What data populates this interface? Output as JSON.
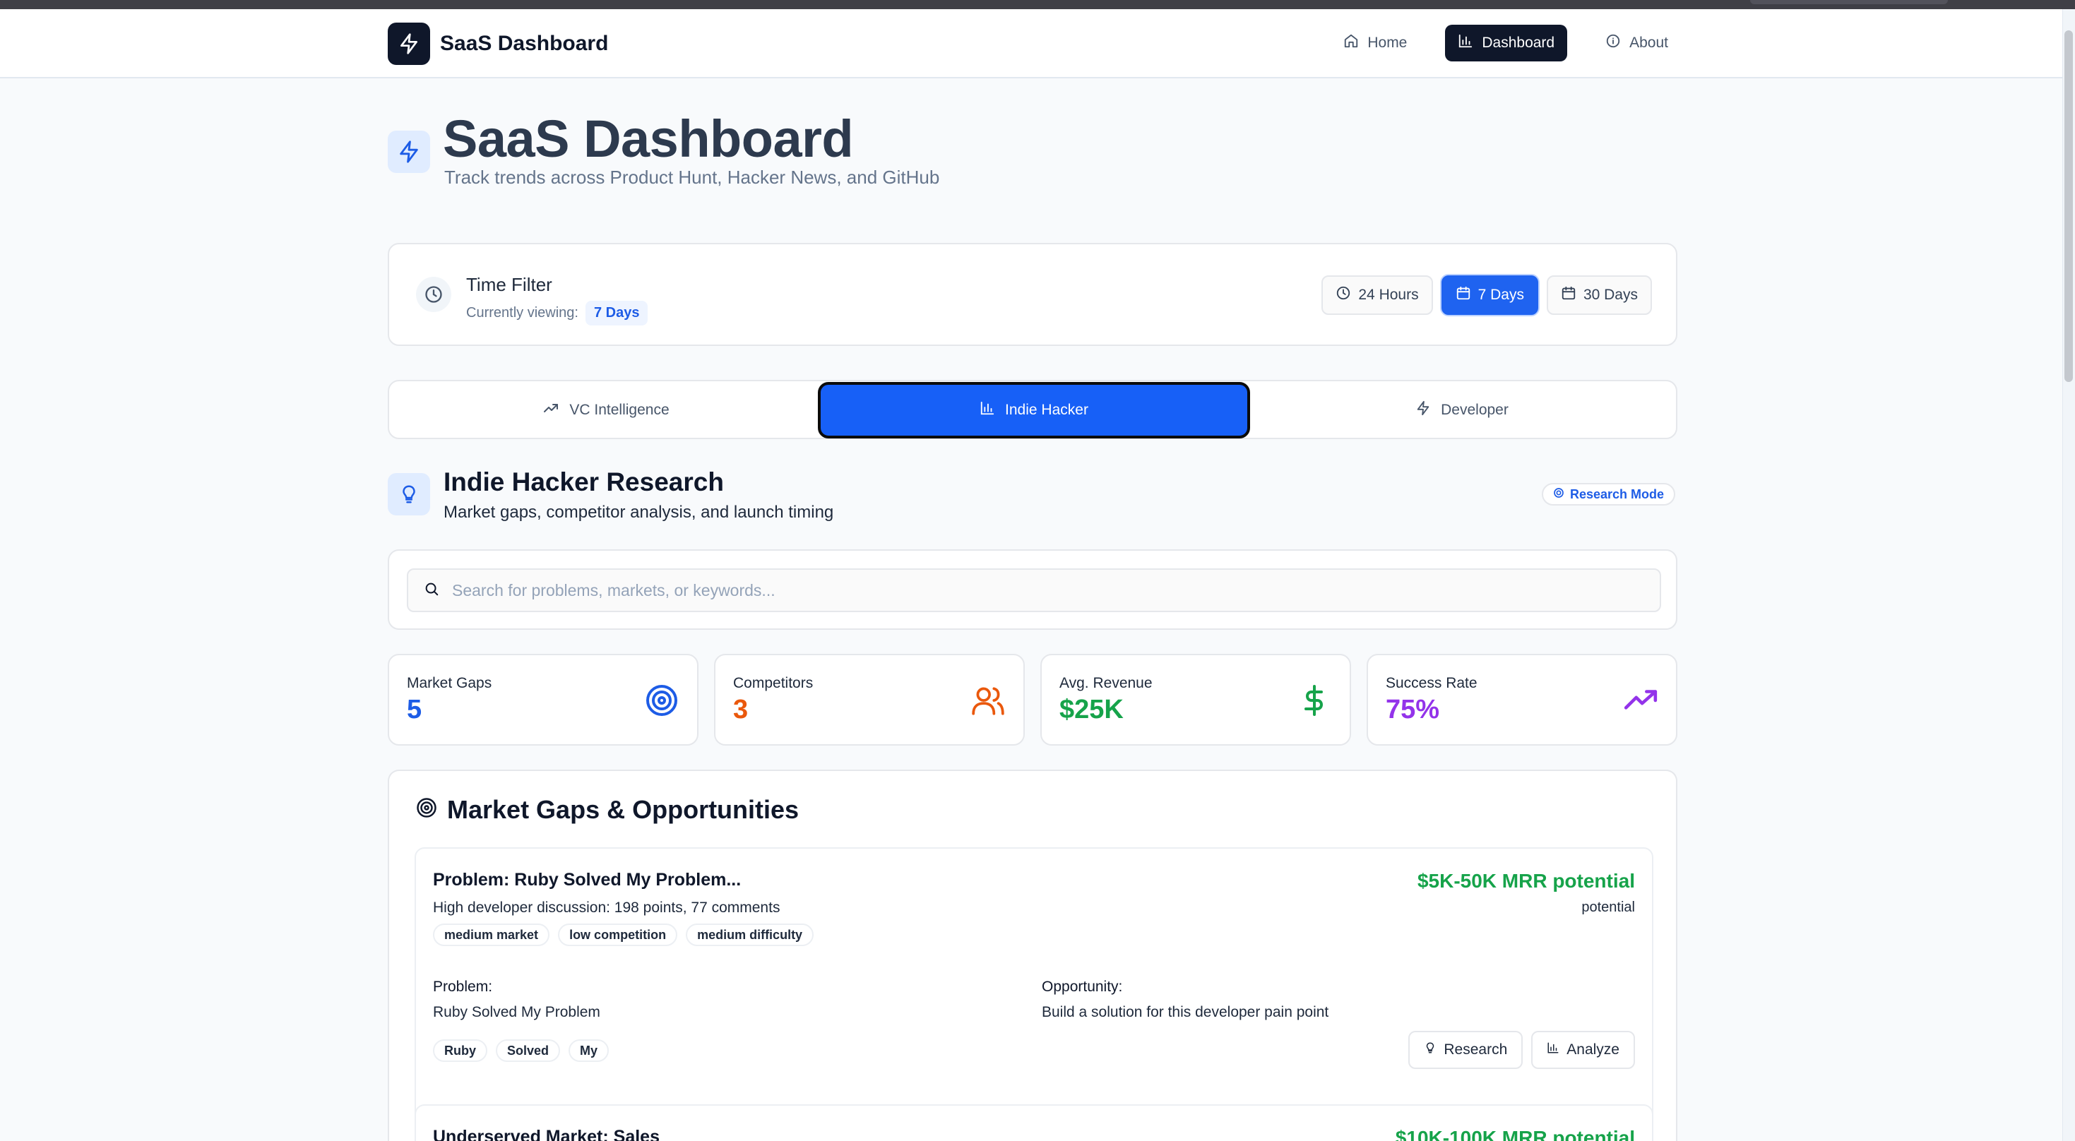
{
  "brand": {
    "name": "SaaS Dashboard",
    "logo_icon": "zap-icon"
  },
  "nav": {
    "items": [
      {
        "label": "Home",
        "icon": "home-icon",
        "active": false
      },
      {
        "label": "Dashboard",
        "icon": "bar-chart-icon",
        "active": true
      },
      {
        "label": "About",
        "icon": "info-icon",
        "active": false
      }
    ]
  },
  "hero": {
    "title": "SaaS Dashboard",
    "subtitle": "Track trends across Product Hunt, Hacker News, and GitHub"
  },
  "time_filter": {
    "title": "Time Filter",
    "viewing_label": "Currently viewing:",
    "viewing_value": "7 Days",
    "options": [
      {
        "label": "24 Hours",
        "icon": "clock-icon",
        "active": false
      },
      {
        "label": "7 Days",
        "icon": "calendar-icon",
        "active": true
      },
      {
        "label": "30 Days",
        "icon": "calendar-icon",
        "active": false
      }
    ]
  },
  "tabs": [
    {
      "label": "VC Intelligence",
      "icon": "trending-up-icon",
      "active": false
    },
    {
      "label": "Indie Hacker",
      "icon": "bar-chart-icon",
      "active": true
    },
    {
      "label": "Developer",
      "icon": "zap-icon",
      "active": false
    }
  ],
  "section": {
    "title": "Indie Hacker Research",
    "subtitle": "Market gaps, competitor analysis, and launch timing",
    "badge": "Research Mode"
  },
  "search": {
    "placeholder": "Search for problems, markets, or keywords...",
    "value": ""
  },
  "stats": [
    {
      "label": "Market Gaps",
      "value": "5",
      "color": "#1d5ce6",
      "icon": "target-icon"
    },
    {
      "label": "Competitors",
      "value": "3",
      "color": "#ea580c",
      "icon": "users-icon"
    },
    {
      "label": "Avg. Revenue",
      "value": "$25K",
      "color": "#16a34a",
      "icon": "dollar-icon"
    },
    {
      "label": "Success Rate",
      "value": "75%",
      "color": "#9333ea",
      "icon": "trending-up-icon"
    }
  ],
  "gaps": {
    "title": "Market Gaps & Opportunities",
    "items": [
      {
        "title": "Problem: Ruby Solved My Problem...",
        "description": "High developer discussion: 198 points, 77 comments",
        "mrr": "$5K-50K MRR potential",
        "mrr_sub": "potential",
        "tags": [
          "medium market",
          "low competition",
          "medium difficulty"
        ],
        "problem_label": "Problem:",
        "problem": "Ruby Solved My Problem",
        "opportunity_label": "Opportunity:",
        "opportunity": "Build a solution for this developer pain point",
        "keywords": [
          "Ruby",
          "Solved",
          "My"
        ],
        "actions": [
          "Research",
          "Analyze"
        ]
      },
      {
        "title": "Underserved Market: Sales",
        "mrr": "$10K-100K MRR potential"
      }
    ]
  },
  "colors": {
    "primary": "#1f63f0",
    "dark": "#0f172a",
    "success": "#16a34a"
  }
}
